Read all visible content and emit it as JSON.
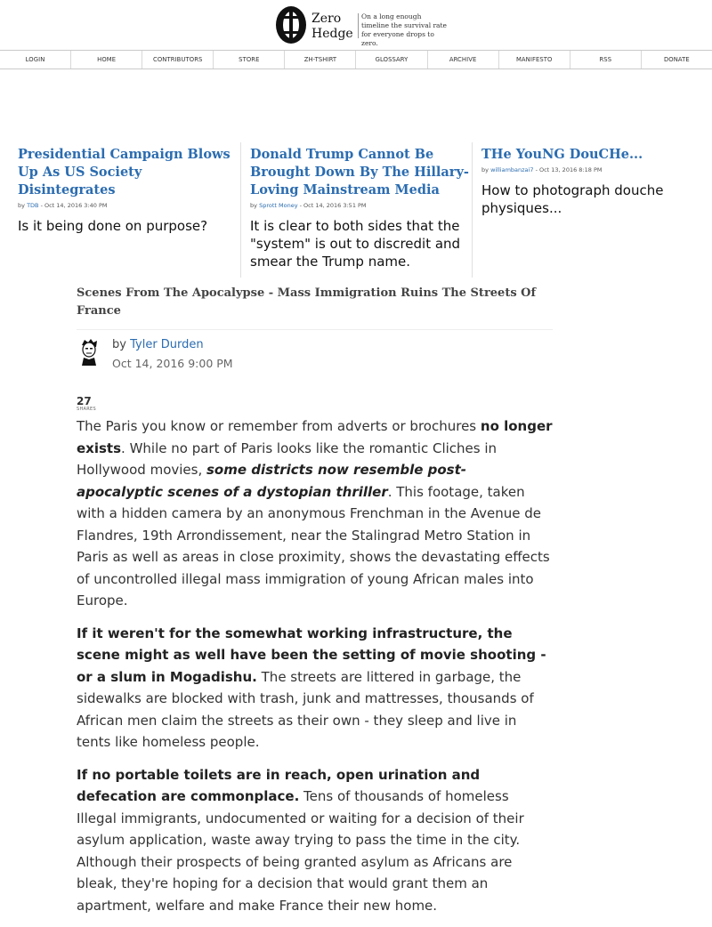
{
  "header": {
    "logo_name_line1": "Zero",
    "logo_name_line2": "Hedge",
    "tagline": "On a long enough timeline the survival rate for everyone drops to zero."
  },
  "nav": [
    "LOGIN",
    "HOME",
    "CONTRIBUTORS",
    "STORE",
    "ZH-TSHIRT",
    "GLOSSARY",
    "ARCHIVE",
    "MANIFESTO",
    "RSS",
    "DONATE"
  ],
  "featured": [
    {
      "title": "Presidential Campaign Blows Up As US Society Disintegrates",
      "by": "by",
      "author": "TDB",
      "date": "- Oct 14, 2016 3:40 PM",
      "teaser": "Is it being done on purpose?"
    },
    {
      "title": "Donald Trump Cannot Be Brought Down By The Hillary-Loving Mainstream Media",
      "by": "by",
      "author": "Sprott Money",
      "date": "- Oct 14, 2016 3:51 PM",
      "teaser": "It is clear to both sides that the \"system\" is out to discredit and smear the Trump name."
    },
    {
      "title": "THe YouNG DouCHe...",
      "by": "by",
      "author": "williambanzai7",
      "date": "- Oct 13, 2016 8:18 PM",
      "teaser": "How to photograph douche physiques..."
    }
  ],
  "article": {
    "title": "Scenes From The Apocalypse - Mass Immigration Ruins The Streets Of France",
    "by": "by",
    "author": "Tyler Durden",
    "date": "Oct 14, 2016 9:00 PM",
    "shares_count": "27",
    "shares_label": "SHARES",
    "p1_a": "The Paris you know or remember from adverts or brochures ",
    "p1_b": "no longer exists",
    "p1_c": ". While no part of Paris looks like the romantic Cliches in Hollywood movies, ",
    "p1_d": "some districts now resemble post-apocalyptic scenes of a dystopian thriller",
    "p1_e": ". This footage, taken with a hidden camera by an anonymous Frenchman in the Avenue de Flandres, 19th Arrondissement, near the Stalingrad Metro Station in Paris as well as areas in close proximity, shows the devastating effects of uncontrolled illegal mass immigration of young African males into Europe.",
    "p2_a": "If it weren't for the somewhat working infrastructure, the scene might as well have been the setting of movie shooting - or a slum in Mogadishu.",
    "p2_b": " The streets are littered in garbage, the sidewalks are blocked with trash, junk and mattresses, thousands of African men claim the streets as their own - they sleep and live in tents like homeless people.",
    "p3_a": "If no portable toilets are in reach, open urination and defecation are commonplace.",
    "p3_b": " Tens of thousands of homeless Illegal immigrants, undocumented or waiting for a decision of their asylum application, waste away trying to pass the time in the city. Although their prospects of being granted asylum as Africans are bleak, they're hoping for a decision that would grant them an apartment, welfare and make France their new home."
  }
}
